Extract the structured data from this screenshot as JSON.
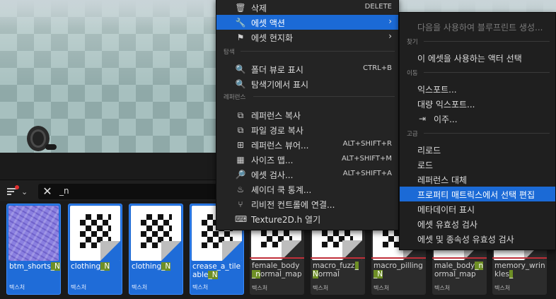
{
  "content_browser": {
    "search_value": "_n",
    "assets": [
      {
        "name_pre": "btm_shorts",
        "name_hl": "_N",
        "name_post": "",
        "type": "텍스처",
        "selected": true,
        "thumb": "normal-map"
      },
      {
        "name_pre": "clothing",
        "name_hl": "_N",
        "name_post": "",
        "type": "텍스처",
        "selected": true,
        "thumb": "checker"
      },
      {
        "name_pre": "clothing",
        "name_hl": "_N",
        "name_post": "",
        "type": "텍스처",
        "selected": true,
        "thumb": "checker"
      },
      {
        "name_pre": "crease_a_tileable",
        "name_hl": "_N",
        "name_post": "",
        "type": "텍스처",
        "selected": true,
        "thumb": "checker"
      },
      {
        "name_pre": "female_body",
        "name_hl": "_n",
        "name_post": "ormal_map",
        "type": "텍스처",
        "selected": false,
        "thumb": "checker"
      },
      {
        "name_pre": "macro_fuzz",
        "name_hl": "_N",
        "name_post": "ormal",
        "type": "텍스처",
        "selected": false,
        "thumb": "checker"
      },
      {
        "name_pre": "macro_pilling",
        "name_hl": "_N",
        "name_post": "",
        "type": "텍스처",
        "selected": false,
        "thumb": "checker"
      },
      {
        "name_pre": "male_body",
        "name_hl": "_n",
        "name_post": "ormal_map",
        "type": "텍스처",
        "selected": false,
        "thumb": "checker"
      },
      {
        "name_pre": "memory_wrinkles",
        "name_hl": "_",
        "name_post": "",
        "type": "텍스처",
        "selected": false,
        "thumb": "checker"
      }
    ]
  },
  "context_menu": {
    "items": [
      {
        "label": "삭제",
        "shortcut": "DELETE",
        "icon": "trash-icon"
      },
      {
        "label": "에셋 액션",
        "arrow": "›",
        "icon": "wrench-icon",
        "active": true
      },
      {
        "label": "에셋 현지화",
        "arrow": "›",
        "icon": "flag-icon"
      },
      {
        "section": "탐색"
      },
      {
        "label": "폴더 뷰로 표시",
        "shortcut": "CTRL+B",
        "icon": "folder-search-icon"
      },
      {
        "label": "탐색기에서 표시",
        "shortcut": "",
        "icon": "folder-search-icon"
      },
      {
        "section": "레퍼런스"
      },
      {
        "label": "레퍼런스 복사",
        "shortcut": "",
        "icon": "copy-icon"
      },
      {
        "label": "파일 경로 복사",
        "shortcut": "",
        "icon": "copy-icon"
      },
      {
        "label": "레퍼런스 뷰어...",
        "shortcut": "ALT+SHIFT+R",
        "icon": "reference-viewer-icon"
      },
      {
        "label": "사이즈 맵...",
        "shortcut": "ALT+SHIFT+M",
        "icon": "size-map-icon"
      },
      {
        "label": "에셋 검사...",
        "shortcut": "ALT+SHIFT+A",
        "icon": "audit-icon"
      },
      {
        "label": "셰이더 쿡 통계...",
        "shortcut": "",
        "icon": "shader-icon"
      },
      {
        "label": "리비전 컨트롤에 연결...",
        "shortcut": "",
        "icon": "revision-icon"
      },
      {
        "label": "Texture2D.h 열기",
        "shortcut": "",
        "icon": "code-file-icon"
      }
    ]
  },
  "submenu": {
    "items": [
      {
        "label": "다음을 사용하여 블루프린트 생성...",
        "disabled": true
      },
      {
        "section": "찾기"
      },
      {
        "label": "이 에셋을 사용하는 액터 선택"
      },
      {
        "section": "이동"
      },
      {
        "label": "익스포트..."
      },
      {
        "label": "대량 익스포트..."
      },
      {
        "label": "이주...",
        "icon": "migrate-icon"
      },
      {
        "section": "고급"
      },
      {
        "label": "리로드"
      },
      {
        "label": "로드"
      },
      {
        "label": "레퍼런스 대체"
      },
      {
        "label": "프로퍼티 매트릭스에서 선택 편집",
        "active": true
      },
      {
        "label": "메타데이터 표시"
      },
      {
        "label": "에셋 유효성 검사"
      },
      {
        "label": "에셋 및 종속성 유효성 검사"
      }
    ]
  },
  "colors": {
    "accent": "#1b6ad6",
    "menu_bg": "#242424",
    "highlight_match": "#6e8f25",
    "selected_tile": "#1f6cd8"
  }
}
